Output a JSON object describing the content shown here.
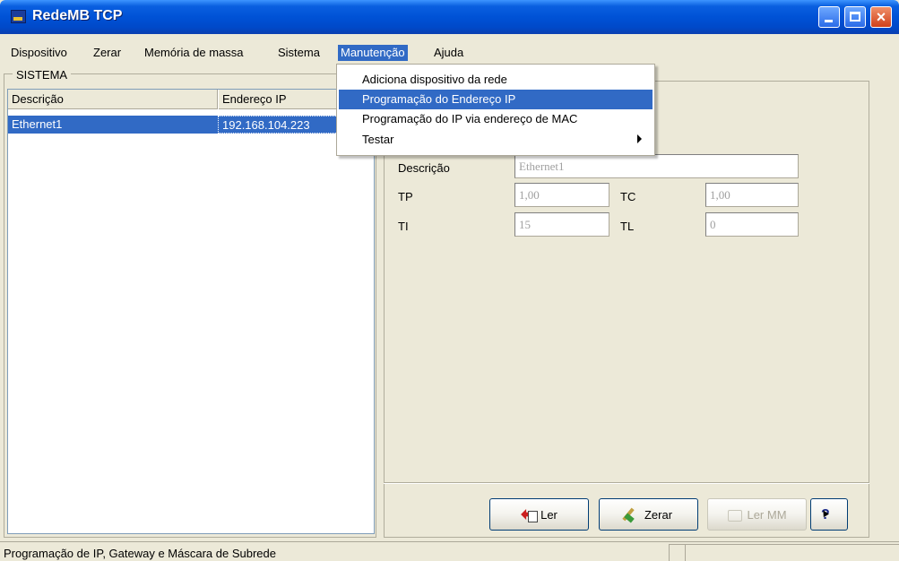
{
  "window": {
    "title": "RedeMB TCP"
  },
  "menubar": [
    "Dispositivo",
    "Zerar",
    "Memória de massa",
    "Sistema",
    "Manutenção",
    "Ajuda"
  ],
  "dropdown": {
    "items": [
      "Adiciona dispositivo da rede",
      "Programação do Endereço IP",
      "Programação do IP via endereço de MAC",
      "Testar"
    ],
    "highlighted": "Programação do Endereço IP"
  },
  "sistema": {
    "legend": "SISTEMA",
    "columns": [
      "Descrição",
      "Endereço IP"
    ],
    "rows": [
      {
        "descricao": "Ethernet1",
        "ip": "192.168.104.223"
      }
    ]
  },
  "props": {
    "descricao_label": "Descrição",
    "descricao_value": "Ethernet1",
    "tp_label": "TP",
    "tp_value": "1,00",
    "tc_label": "TC",
    "tc_value": "1,00",
    "ti_label": "TI",
    "ti_value": "15",
    "tl_label": "TL",
    "tl_value": "0"
  },
  "buttons": {
    "ler": "Ler",
    "zerar": "Zerar",
    "ler_mm": "Ler MM"
  },
  "icons": {
    "ler": "read-arrow-icon",
    "zerar": "broom-icon",
    "ler_mm": "memory-icon",
    "help": "pointer-help-icon"
  },
  "status": {
    "text": "Programação de IP, Gateway e Máscara de Subrede"
  },
  "colors": {
    "titlebar": "#0052d6",
    "selection": "#316ac5",
    "face": "#ece9d8"
  }
}
